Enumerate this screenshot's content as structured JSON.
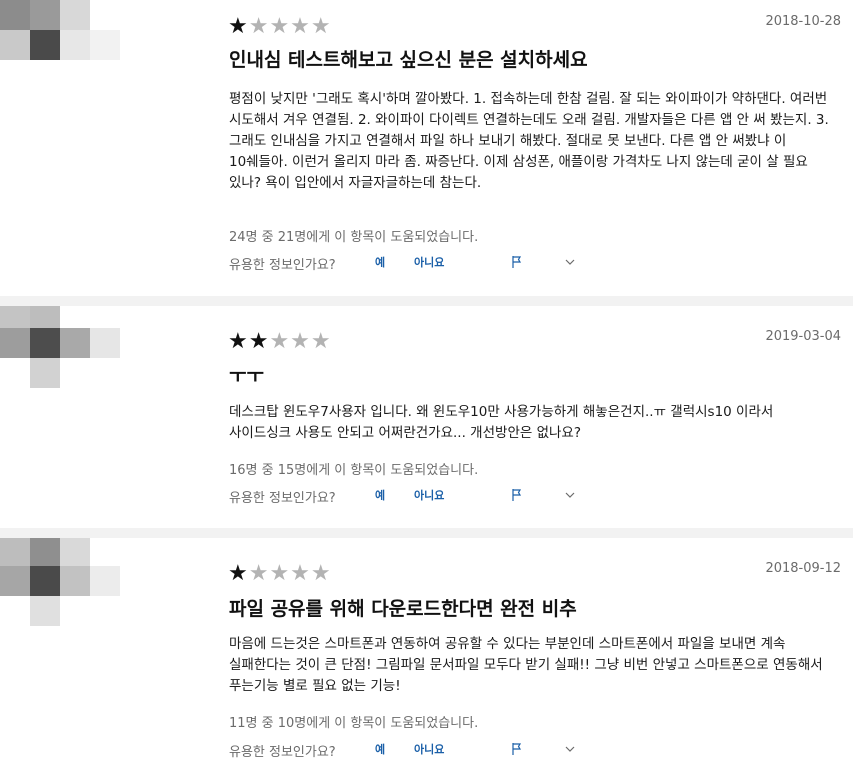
{
  "reviews": [
    {
      "rating": 1,
      "date": "2018-10-28",
      "title": "인내심 테스트해보고 싶으신 분은 설치하세요",
      "body": "평점이 낮지만 '그래도 혹시'하며 깔아봤다. 1. 접속하는데 한참 걸림. 잘 되는 와이파이가 약하댄다. 여러번 시도해서 겨우 연결됨. 2. 와이파이 다이렉트 연결하는데도 오래 걸림. 개발자들은 다른 앱 안 써 봤는지. 3. 그래도 인내심을 가지고 연결해서 파일 하나 보내기 해봤다. 절대로 못 보낸다. 다른 앱 안 써봤냐 이 10쉐들아. 이런거 올리지 마라 좀. 짜증난다. 이제 삼성폰, 애플이랑 가격차도 나지 않는데 굳이 살 필요 있나? 욕이 입안에서 자글자글하는데 참는다.",
      "helpful": "24명 중 21명에게 이 항목이 도움되었습니다.",
      "useful_q": "유용한 정보인가요?",
      "yes": "예",
      "no": "아니요"
    },
    {
      "rating": 2,
      "date": "2019-03-04",
      "title": "ㅜㅜ",
      "body": "데스크탑 윈도우7사용자 입니다. 왜 윈도우10만 사용가능하게 해놓은건지..ㅠ 갤럭시s10 이라서 사이드싱크 사용도 안되고 어쩌란건가요... 개선방안은 없나요?",
      "helpful": "16명 중 15명에게 이 항목이 도움되었습니다.",
      "useful_q": "유용한 정보인가요?",
      "yes": "예",
      "no": "아니요"
    },
    {
      "rating": 1,
      "date": "2018-09-12",
      "title": "파일 공유를 위해 다운로드한다면 완전 비추",
      "body": "마음에 드는것은 스마트폰과 연동하여 공유할 수 있다는 부분인데 스마트폰에서 파일을 보내면 계속 실패한다는 것이 큰 단점! 그림파일 문서파일 모두다 받기 실패!! 그냥 비번 안넣고 스마트폰으로 연동해서 푸는기능 별로 필요 없는 기능!",
      "helpful": "11명 중 10명에게 이 항목이 도움되었습니다.",
      "useful_q": "유용한 정보인가요?",
      "yes": "예",
      "no": "아니요"
    }
  ],
  "icons": {
    "flag": "flag-icon",
    "chevron": "chevron-down-icon",
    "star_on_color": "#111111",
    "star_off_color": "#b3b3b3",
    "link_color": "#1a5fa8"
  }
}
